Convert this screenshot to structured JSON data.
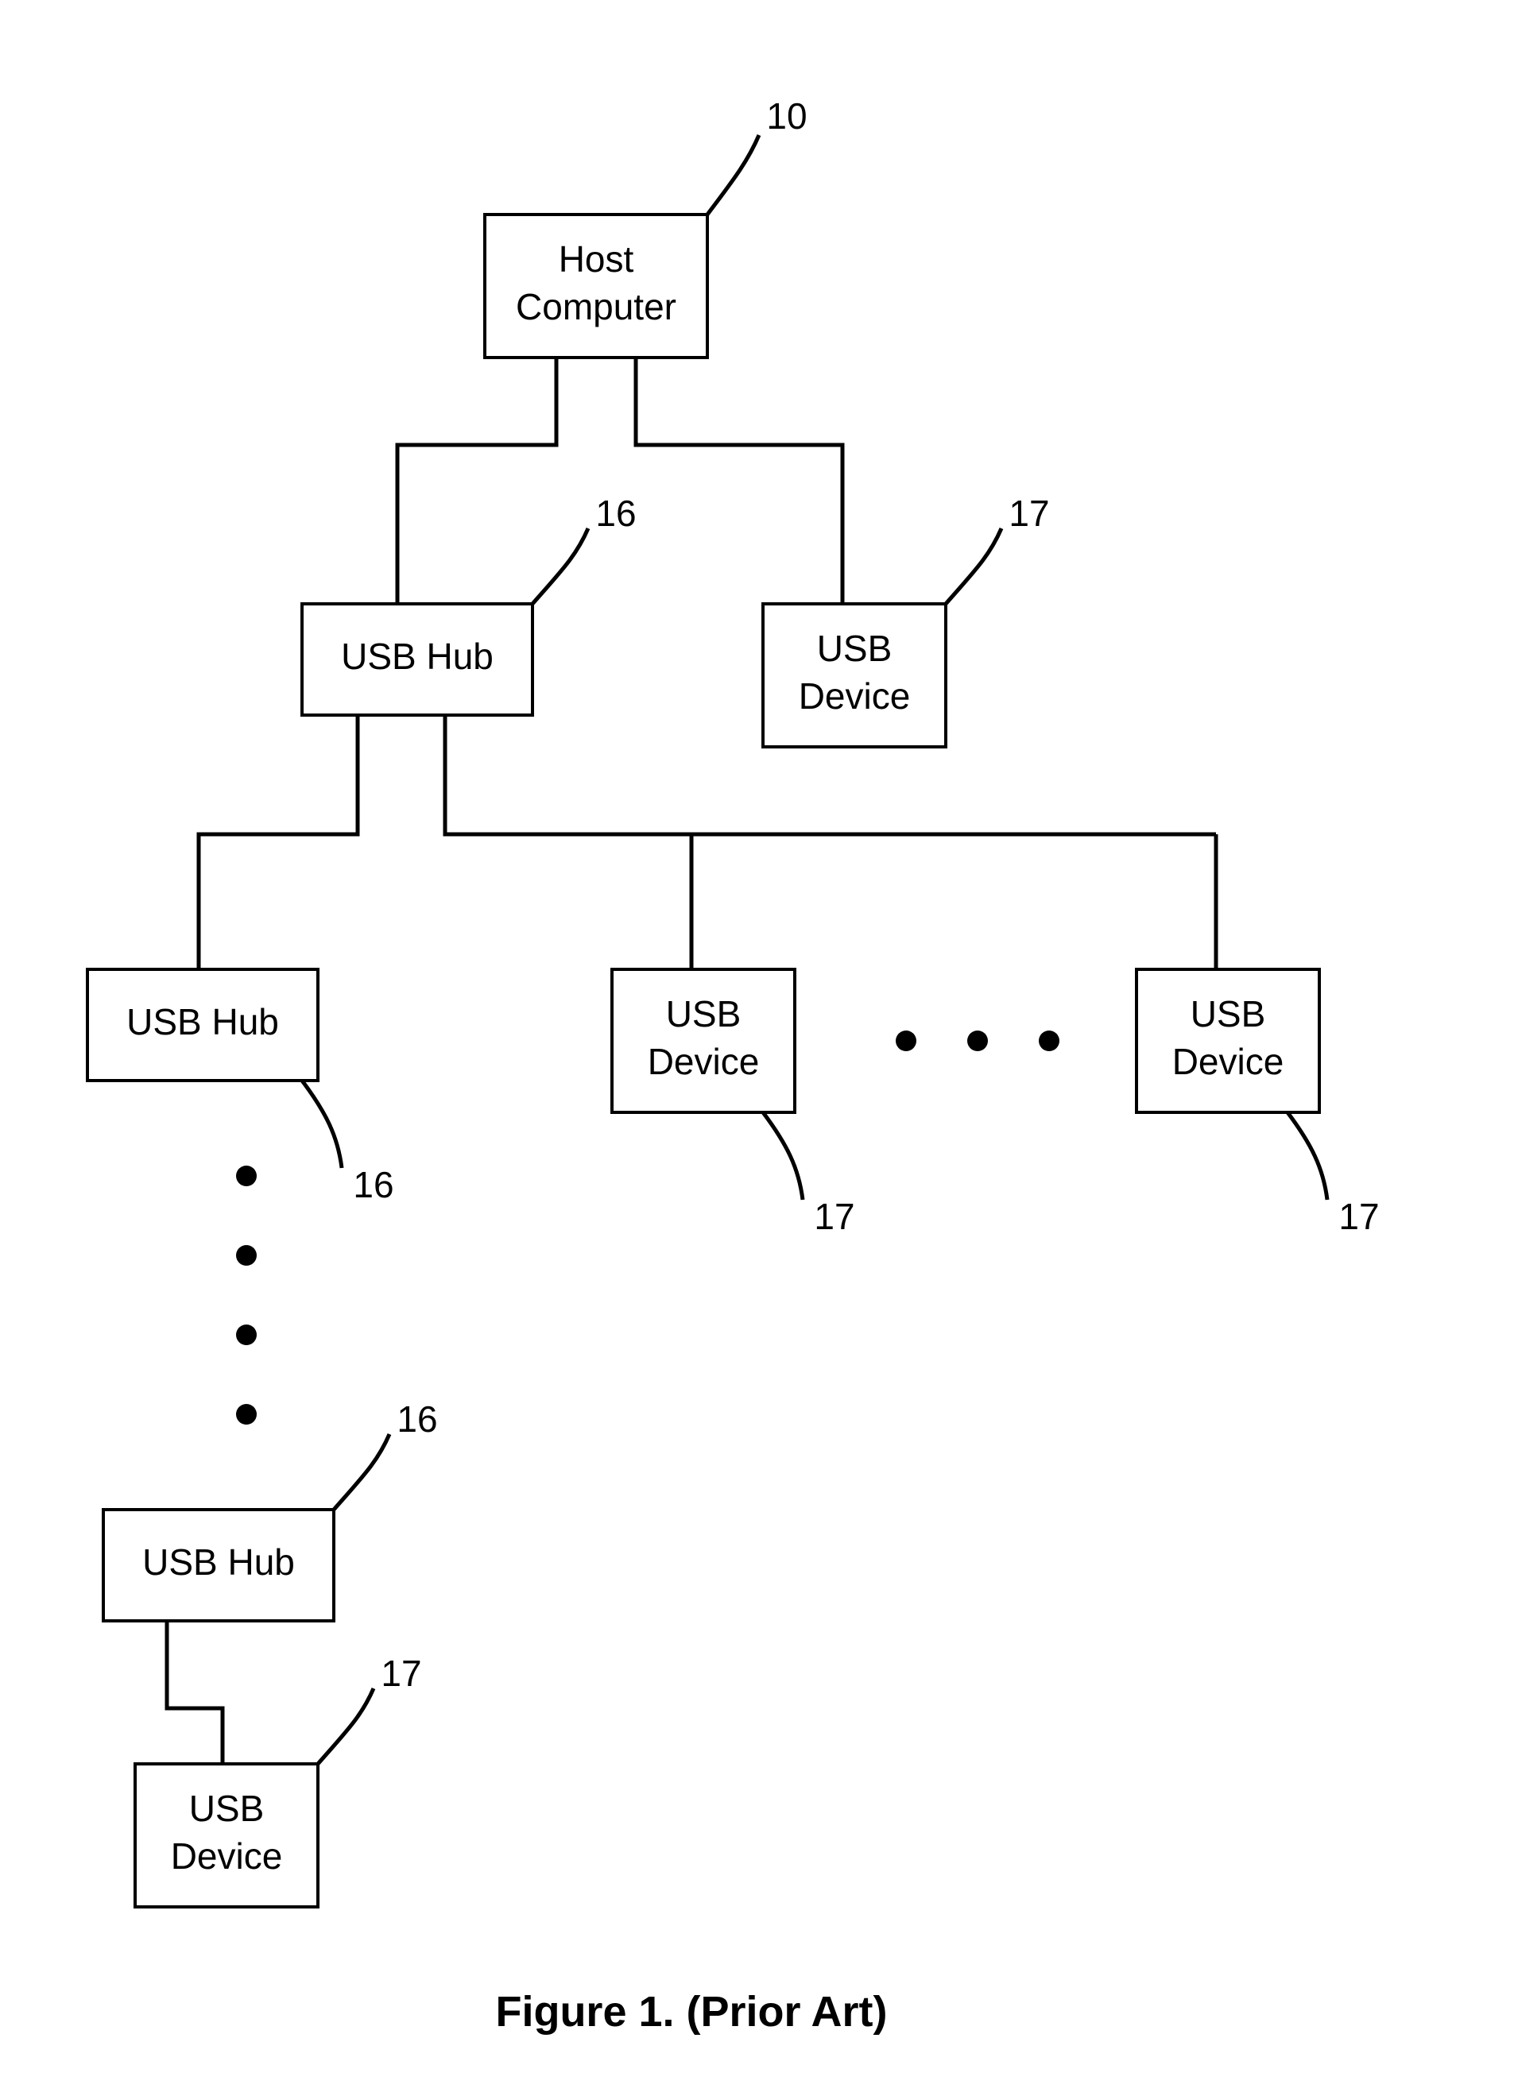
{
  "caption": "Figure 1. (Prior Art)",
  "host": {
    "line1": "Host",
    "line2": "Computer",
    "ref": "10"
  },
  "hub_l1": {
    "label": "USB Hub",
    "ref": "16"
  },
  "dev_l1": {
    "line1": "USB",
    "line2": "Device",
    "ref": "17"
  },
  "hub_l2": {
    "label": "USB Hub",
    "ref": "16"
  },
  "dev_l2a": {
    "line1": "USB",
    "line2": "Device",
    "ref": "17"
  },
  "dev_l2b": {
    "line1": "USB",
    "line2": "Device",
    "ref": "17"
  },
  "hub_l3": {
    "label": "USB Hub",
    "ref": "16"
  },
  "dev_l3": {
    "line1": "USB",
    "line2": "Device",
    "ref": "17"
  }
}
